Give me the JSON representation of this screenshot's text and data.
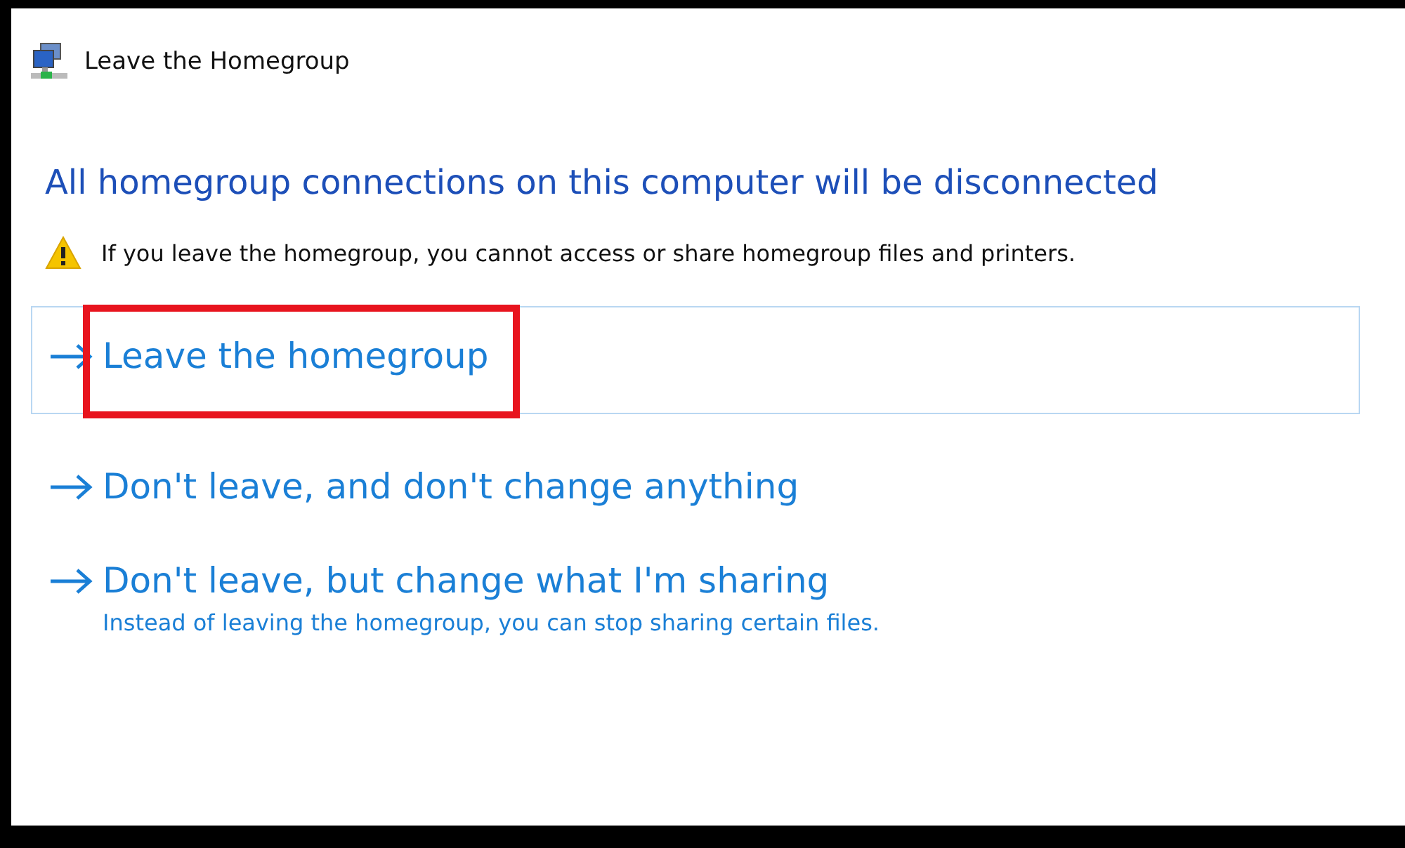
{
  "window": {
    "title": "Leave the Homegroup"
  },
  "heading": "All homegroup connections on this computer will be disconnected",
  "warning": "If you leave the homegroup, you cannot access or share homegroup files and printers.",
  "options": [
    {
      "label": "Leave the homegroup",
      "selected": true,
      "highlighted": true
    },
    {
      "label": "Don't leave, and don't change anything",
      "selected": false,
      "highlighted": false
    },
    {
      "label": "Don't leave, but change what I'm sharing",
      "description": "Instead of leaving the homegroup, you can stop sharing certain files.",
      "selected": false,
      "highlighted": false
    }
  ]
}
